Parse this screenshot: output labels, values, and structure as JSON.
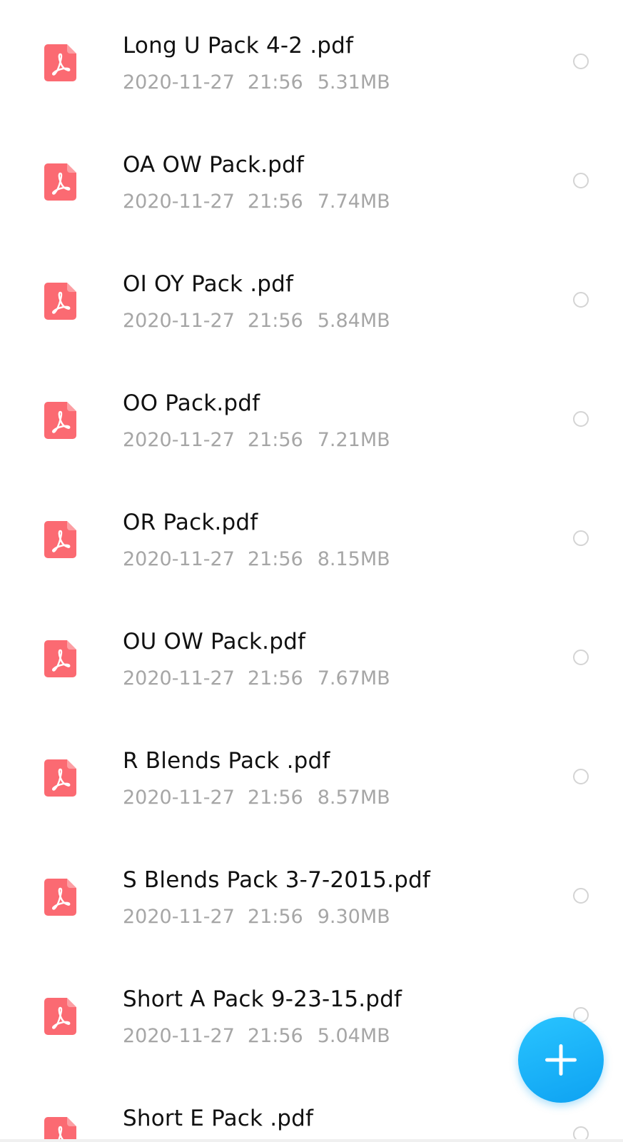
{
  "colors": {
    "pdf_icon": "#fb6a72",
    "file_name": "#111111",
    "meta_text": "#a6a6a6",
    "radio_border": "#d4d4d4",
    "fab_accent": "#1ab2f8"
  },
  "icons": {
    "file": "pdf-file-icon",
    "select": "radio-unchecked-icon",
    "fab": "plus-icon"
  },
  "files": [
    {
      "name": "Long U Pack 4-2 .pdf",
      "date": "2020-11-27",
      "time": "21:56",
      "size": "5.31MB"
    },
    {
      "name": "OA OW Pack.pdf",
      "date": "2020-11-27",
      "time": "21:56",
      "size": "7.74MB"
    },
    {
      "name": "OI OY Pack .pdf",
      "date": "2020-11-27",
      "time": "21:56",
      "size": "5.84MB"
    },
    {
      "name": "OO Pack.pdf",
      "date": "2020-11-27",
      "time": "21:56",
      "size": "7.21MB"
    },
    {
      "name": "OR Pack.pdf",
      "date": "2020-11-27",
      "time": "21:56",
      "size": "8.15MB"
    },
    {
      "name": "OU OW Pack.pdf",
      "date": "2020-11-27",
      "time": "21:56",
      "size": "7.67MB"
    },
    {
      "name": "R Blends Pack .pdf",
      "date": "2020-11-27",
      "time": "21:56",
      "size": "8.57MB"
    },
    {
      "name": "S Blends Pack 3-7-2015.pdf",
      "date": "2020-11-27",
      "time": "21:56",
      "size": "9.30MB"
    },
    {
      "name": "Short A Pack 9-23-15.pdf",
      "date": "2020-11-27",
      "time": "21:56",
      "size": "5.04MB"
    },
    {
      "name": "Short E Pack .pdf",
      "date": "",
      "time": "",
      "size": ""
    }
  ]
}
